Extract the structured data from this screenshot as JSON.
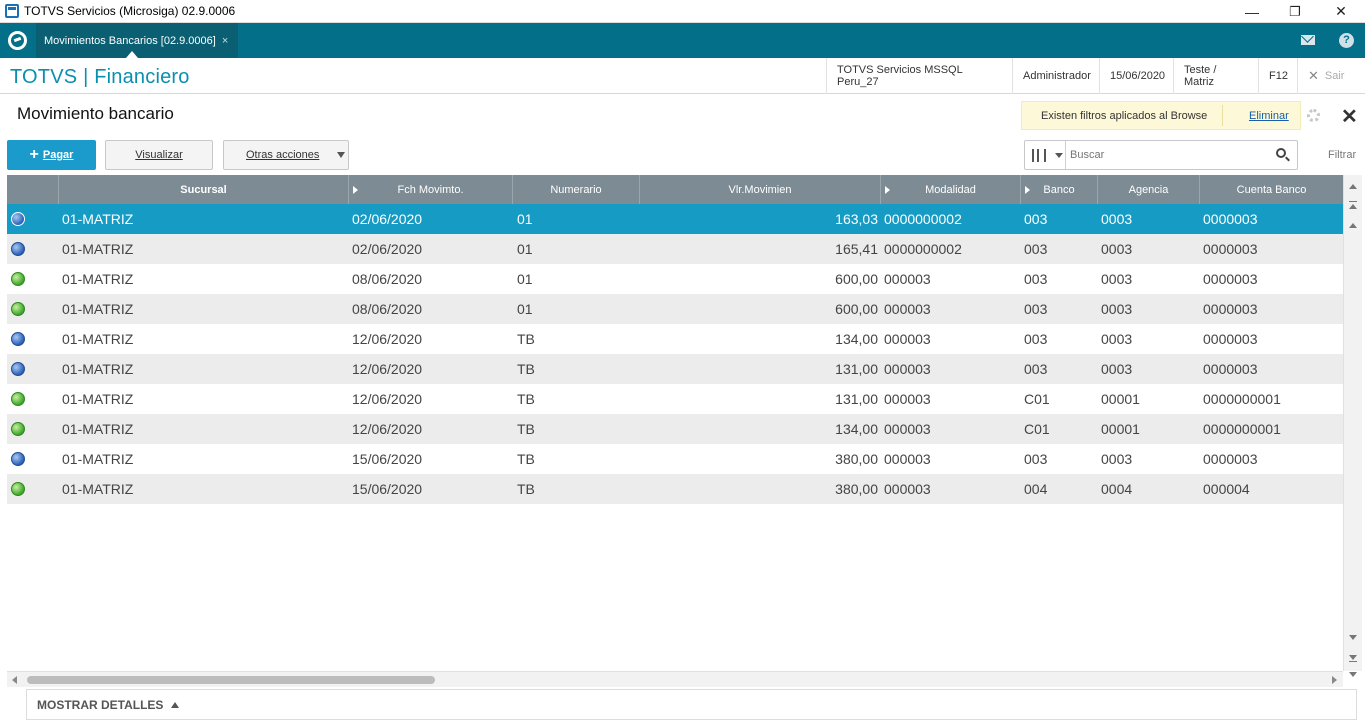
{
  "window": {
    "title": "TOTVS Servicios (Microsiga) 02.9.0006",
    "minimize_label": "—",
    "maximize_label": "❐",
    "close_label": "✕"
  },
  "tabbar": {
    "tab_label": "Movimientos Bancarios [02.9.0006]",
    "tab_close": "×",
    "help_label": "?"
  },
  "header": {
    "brand": "TOTVS | Financiero",
    "environment": "TOTVS Servicios MSSQL Peru_27",
    "user": "Administrador",
    "date": "15/06/2020",
    "company": "Teste / Matriz",
    "shortcut": "F12",
    "exit_label": "Sair"
  },
  "page": {
    "title": "Movimiento bancario",
    "filter_message": "Existen filtros aplicados al Browse",
    "filter_remove": "Eliminar"
  },
  "toolbar": {
    "pay_label": "Pagar",
    "view_label": "Visualizar",
    "other_actions_label": "Otras acciones",
    "search_placeholder": "Buscar",
    "filter_label": "Filtrar"
  },
  "table": {
    "columns": [
      "",
      "Sucursal",
      "Fch Movimto.",
      "Numerario",
      "Vlr.Movimien",
      "Modalidad",
      "Banco",
      "Agencia",
      "Cuenta Banco"
    ],
    "rows": [
      {
        "status": "blue",
        "sucursal": "01-MATRIZ",
        "fecha": "02/06/2020",
        "numerario": "01",
        "valor": "163,03",
        "modalidad": "0000000002",
        "banco": "003",
        "agencia": "0003",
        "cuenta": "0000003"
      },
      {
        "status": "blue",
        "sucursal": "01-MATRIZ",
        "fecha": "02/06/2020",
        "numerario": "01",
        "valor": "165,41",
        "modalidad": "0000000002",
        "banco": "003",
        "agencia": "0003",
        "cuenta": "0000003"
      },
      {
        "status": "green",
        "sucursal": "01-MATRIZ",
        "fecha": "08/06/2020",
        "numerario": "01",
        "valor": "600,00",
        "modalidad": "000003",
        "banco": "003",
        "agencia": "0003",
        "cuenta": "0000003"
      },
      {
        "status": "green",
        "sucursal": "01-MATRIZ",
        "fecha": "08/06/2020",
        "numerario": "01",
        "valor": "600,00",
        "modalidad": "000003",
        "banco": "003",
        "agencia": "0003",
        "cuenta": "0000003"
      },
      {
        "status": "blue",
        "sucursal": "01-MATRIZ",
        "fecha": "12/06/2020",
        "numerario": "TB",
        "valor": "134,00",
        "modalidad": "000003",
        "banco": "003",
        "agencia": "0003",
        "cuenta": "0000003"
      },
      {
        "status": "blue",
        "sucursal": "01-MATRIZ",
        "fecha": "12/06/2020",
        "numerario": "TB",
        "valor": "131,00",
        "modalidad": "000003",
        "banco": "003",
        "agencia": "0003",
        "cuenta": "0000003"
      },
      {
        "status": "green",
        "sucursal": "01-MATRIZ",
        "fecha": "12/06/2020",
        "numerario": "TB",
        "valor": "131,00",
        "modalidad": "000003",
        "banco": "C01",
        "agencia": "00001",
        "cuenta": "0000000001"
      },
      {
        "status": "green",
        "sucursal": "01-MATRIZ",
        "fecha": "12/06/2020",
        "numerario": "TB",
        "valor": "134,00",
        "modalidad": "000003",
        "banco": "C01",
        "agencia": "00001",
        "cuenta": "0000000001"
      },
      {
        "status": "blue",
        "sucursal": "01-MATRIZ",
        "fecha": "15/06/2020",
        "numerario": "TB",
        "valor": "380,00",
        "modalidad": "000003",
        "banco": "003",
        "agencia": "0003",
        "cuenta": "0000003"
      },
      {
        "status": "green",
        "sucursal": "01-MATRIZ",
        "fecha": "15/06/2020",
        "numerario": "TB",
        "valor": "380,00",
        "modalidad": "000003",
        "banco": "004",
        "agencia": "0004",
        "cuenta": "000004"
      }
    ]
  },
  "footer": {
    "details_label": "MOSTRAR DETALLES"
  },
  "colors": {
    "brand": "#0b8fb0",
    "tabbar": "#036f88",
    "selected_row": "#159bc4",
    "primary_button": "#1a9bcc"
  }
}
